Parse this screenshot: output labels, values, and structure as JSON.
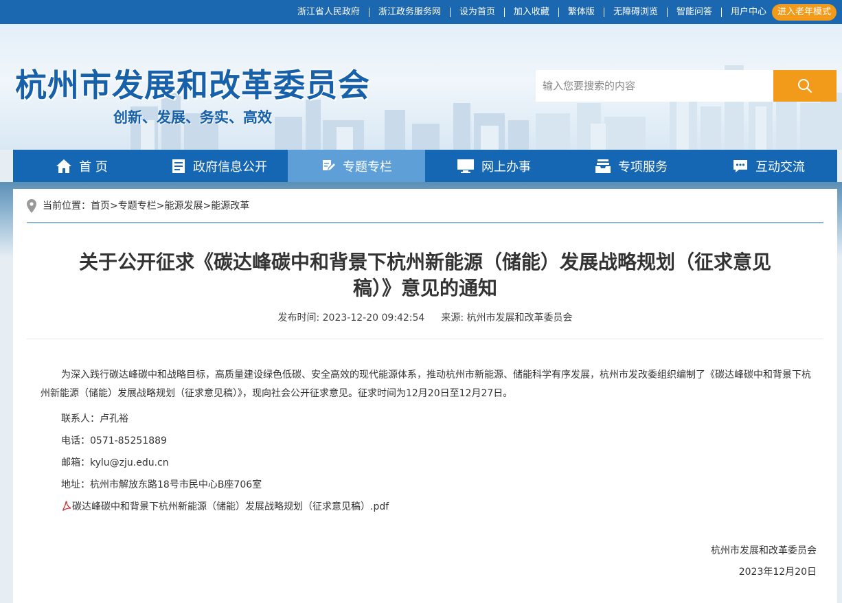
{
  "topbar": {
    "links": [
      "浙江省人民政府",
      "浙江政务服务网",
      "设为首页",
      "加入收藏",
      "繁体版",
      "无障碍浏览",
      "智能问答",
      "用户中心"
    ],
    "elder_mode": "进入老年模式"
  },
  "header": {
    "site_title": "杭州市发展和改革委员会",
    "slogan": "创新、发展、务实、高效",
    "search_placeholder": "输入您要搜索的内容"
  },
  "nav": {
    "items": [
      {
        "label": "首 页",
        "icon": "home-icon"
      },
      {
        "label": "政府信息公开",
        "icon": "document-icon"
      },
      {
        "label": "专题专栏",
        "icon": "edit-icon"
      },
      {
        "label": "网上办事",
        "icon": "monitor-icon"
      },
      {
        "label": "专项服务",
        "icon": "inbox-icon"
      },
      {
        "label": "互动交流",
        "icon": "chat-icon"
      }
    ],
    "active_index": 2
  },
  "breadcrumb": {
    "label": "当前位置：",
    "items": [
      "首页",
      "专题专栏",
      "能源发展",
      "能源改革"
    ],
    "separator": ">"
  },
  "article": {
    "title_line1": "关于公开征求《碳达峰碳中和背景下杭州新能源（储能）发展战略规划（征求意见",
    "title_line2": "稿）》意见的通知",
    "publish_time": "发布时间: 2023-12-20 09:42:54",
    "source": "来源: 杭州市发展和改革委员会",
    "paragraph": "为深入践行碳达峰碳中和战略目标，高质量建设绿色低碳、安全高效的现代能源体系，推动杭州市新能源、储能科学有序发展，杭州市发改委组织编制了《碳达峰碳中和背景下杭州新能源（储能）发展战略规划（征求意见稿）》，现向社会公开征求意见。征求时间为12月20日至12月27日。",
    "contact": "联系人：卢孔裕",
    "phone": "电话：0571-85251889",
    "email": "邮箱：kylu@zju.edu.cn",
    "address": "地址：杭州市解放东路18号市民中心B座706室",
    "attachment": "碳达峰碳中和背景下杭州新能源（储能）发展战略规划（征求意见稿）.pdf",
    "sign_org": "杭州市发展和改革委员会",
    "sign_date": "2023年12月20日"
  },
  "colors": {
    "primary": "#1567b3",
    "nav_active": "#5e9fd8",
    "accent": "#f29a1a"
  }
}
